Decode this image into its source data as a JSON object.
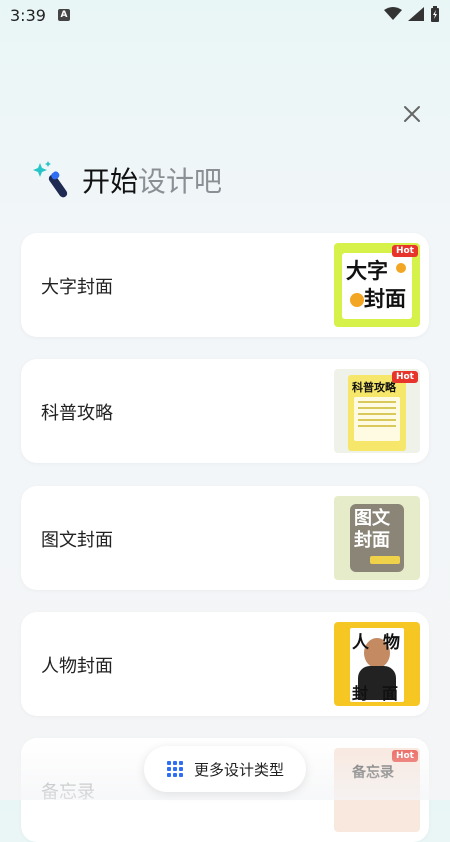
{
  "status_bar": {
    "time": "3:39",
    "badge": "A"
  },
  "header": {
    "title_main": "开始",
    "title_sub": "设计吧"
  },
  "cards": [
    {
      "label": "大字封面",
      "badge": "Hot",
      "thumb_text": [
        "大字",
        "封面"
      ],
      "thumb_bg": "#d6f24a"
    },
    {
      "label": "科普攻略",
      "badge": "Hot",
      "thumb_text": [
        "科普攻略"
      ],
      "thumb_bg": "#f6e76a"
    },
    {
      "label": "图文封面",
      "badge": "",
      "thumb_text": [
        "图文",
        "封面"
      ],
      "thumb_bg": "#e6ecc9"
    },
    {
      "label": "人物封面",
      "badge": "",
      "thumb_text": [
        "人物",
        "封面"
      ],
      "thumb_bg": "#f6c623"
    },
    {
      "label": "备忘录",
      "badge": "Hot",
      "thumb_text": [
        "备忘录"
      ],
      "thumb_bg": "#f8e3d6"
    }
  ],
  "more_button": {
    "label": "更多设计类型",
    "icon": "grid-dots-icon"
  },
  "colors": {
    "accent": "#2d6ef5",
    "hot": "#e8352c"
  }
}
